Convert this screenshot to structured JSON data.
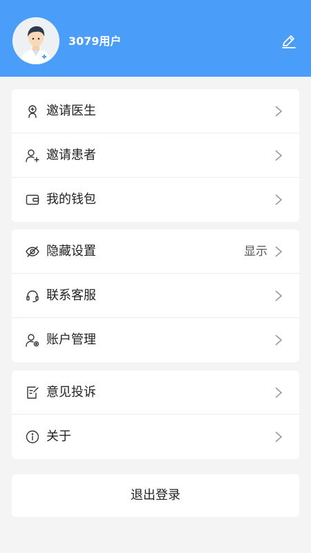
{
  "header": {
    "username": "3079用户",
    "avatar_icon": "doctor-avatar",
    "edit_icon": "pencil-icon",
    "background_color": "#4a9df8"
  },
  "group1": {
    "items": [
      {
        "label": "邀请医生",
        "icon": "doctor-icon"
      },
      {
        "label": "邀请患者",
        "icon": "user-plus-icon"
      },
      {
        "label": "我的钱包",
        "icon": "wallet-icon"
      }
    ]
  },
  "group2": {
    "items": [
      {
        "label": "隐藏设置",
        "value": "显示",
        "icon": "eye-off-icon"
      },
      {
        "label": "联系客服",
        "icon": "headset-icon"
      },
      {
        "label": "账户管理",
        "icon": "user-settings-icon"
      }
    ]
  },
  "group3": {
    "items": [
      {
        "label": "意见投诉",
        "icon": "feedback-icon"
      },
      {
        "label": "关于",
        "icon": "info-icon"
      }
    ]
  },
  "logout": {
    "label": "退出登录"
  }
}
